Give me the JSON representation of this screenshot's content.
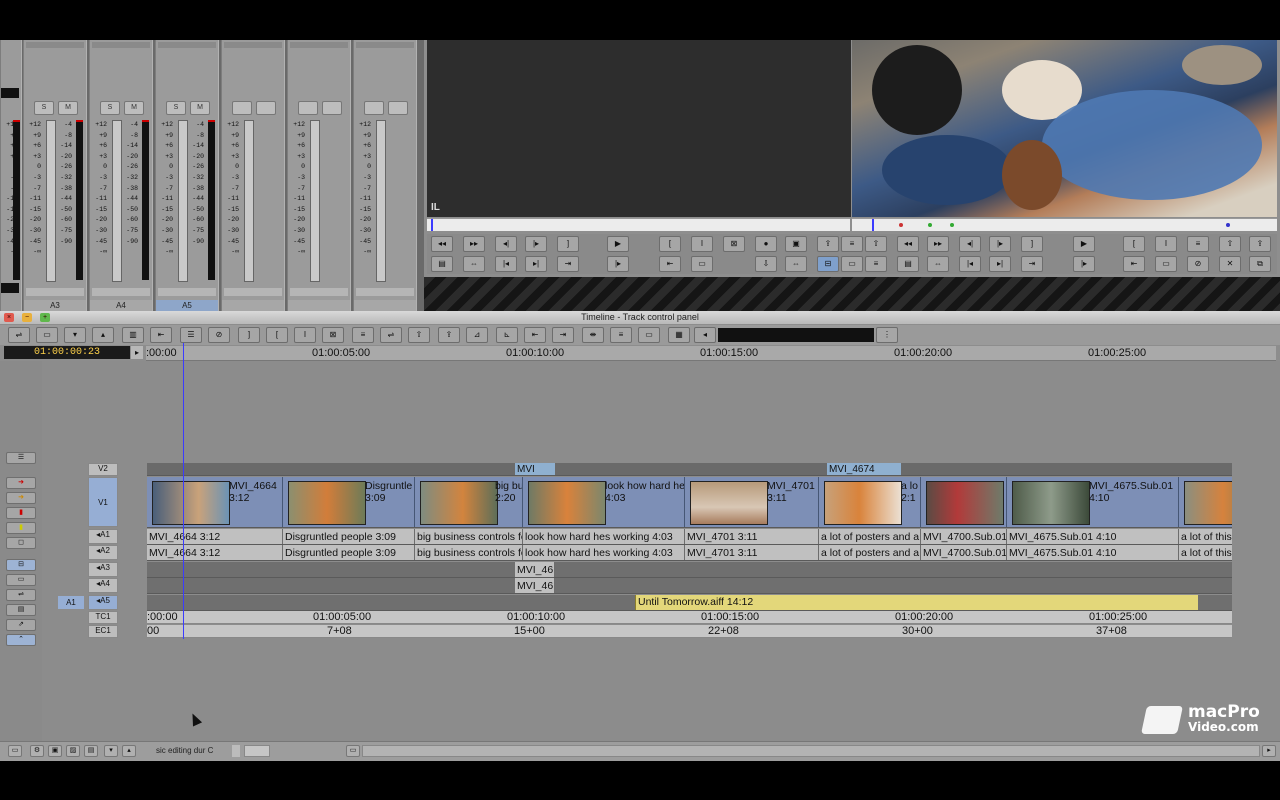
{
  "mixer": {
    "channels": [
      {
        "label": "",
        "selected": false
      },
      {
        "label": "A3",
        "selected": false
      },
      {
        "label": "A4",
        "selected": false
      },
      {
        "label": "A5",
        "selected": true
      },
      {
        "label": "",
        "selected": false
      },
      {
        "label": "",
        "selected": false
      },
      {
        "label": "",
        "selected": false
      }
    ],
    "scale_left": [
      "+12",
      "+9",
      "+6",
      "+3",
      "0",
      "-3",
      "-7",
      "-11",
      "-15",
      "-20",
      "-30",
      "-45",
      "-∞"
    ],
    "scale_right": [
      "-4",
      "-8",
      "-14",
      "-20",
      "-26",
      "-32",
      "-38",
      "-44",
      "-50",
      "-60",
      "-75",
      "-90"
    ]
  },
  "monitors": {
    "source_overlay": "IL"
  },
  "timeline": {
    "title": "Timeline - Track control panel",
    "position_timecode": "01:00:00:23",
    "ruler": [
      "01:00:00:00",
      "01:00:05:00",
      "01:00:10:00",
      "01:00:15:00",
      "01:00:20:00",
      "01:00:25:00"
    ],
    "ruler_first_visible": ":00:00",
    "tracks": {
      "v2": "V2",
      "v1": "V1",
      "a1": "◂A1",
      "a2": "◂A2",
      "a3": "◂A3",
      "a4": "◂A4",
      "a5": "◂A5",
      "tc1": "TC1",
      "ec1": "EC1",
      "a1_patch": "A1"
    },
    "v2_clips": [
      {
        "name": "MVI"
      },
      {
        "name": "MVI_4674"
      }
    ],
    "v1_clips": [
      {
        "name": "MVI_4664",
        "dur": "3:12"
      },
      {
        "name": "Disgruntle",
        "dur": "3:09"
      },
      {
        "name": "big bu",
        "dur": "2:20"
      },
      {
        "name": "look how hard he",
        "dur": "4:03"
      },
      {
        "name": "MVI_4701",
        "dur": "3:11"
      },
      {
        "name": "a lo",
        "dur": "2:1"
      },
      {
        "name": "",
        "dur": ""
      },
      {
        "name": "MVI_4675.Sub.01",
        "dur": "4:10"
      },
      {
        "name": "",
        "dur": ""
      }
    ],
    "a1_clips": [
      "MVI_4664 3:12",
      "Disgruntled people 3:09",
      "big business controls fo",
      "look how hard hes working 4:03",
      "MVI_4701 3:11",
      "a lot of posters and a",
      "MVI_4700.Sub.01",
      "MVI_4675.Sub.01 4:10",
      "a lot of this"
    ],
    "a2_clips": [
      "MVI_4664 3:12",
      "Disgruntled people 3:09",
      "big business controls fo",
      "look how hard hes working 4:03",
      "MVI_4701 3:11",
      "a lot of posters and a",
      "MVI_4700.Sub.01",
      "MVI_4675.Sub.01 4:10",
      "a lot of this"
    ],
    "a3_clip": "MVI_46",
    "a4_clip": "MVI_46",
    "a5_clip": "Until Tomorrow.aiff 14:12",
    "tc1_labels": [
      ":00:00",
      "01:00:05:00",
      "01:00:10:00",
      "01:00:15:00",
      "01:00:20:00",
      "01:00:25:00"
    ],
    "ec1_labels": [
      "00",
      "7+08",
      "15+00",
      "22+08",
      "30+00",
      "37+08"
    ],
    "bin_label": "sic editing dur C"
  },
  "logo": {
    "line1": "macPro",
    "line2": "Video.com"
  },
  "colors": {
    "video_clip": "#7d8fb6",
    "audio_clip": "#c0c0c0",
    "music_clip": "#e3d77a",
    "playhead": "#3b3bff",
    "timecode": "#ffd24a"
  }
}
